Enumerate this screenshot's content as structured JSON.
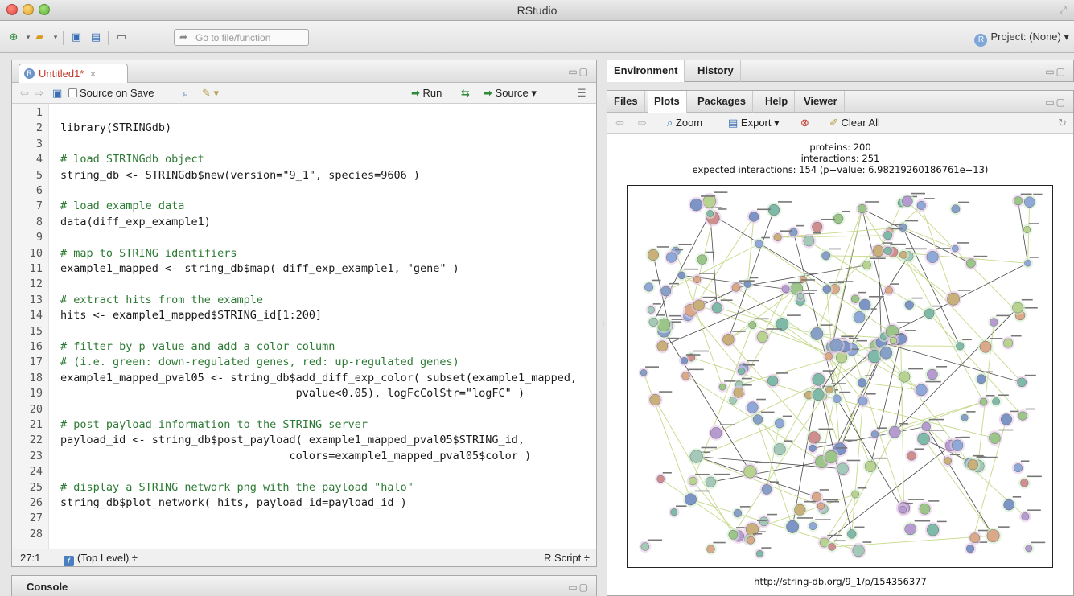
{
  "window": {
    "title": "RStudio"
  },
  "toolbar": {
    "goto_placeholder": "Go to file/function",
    "project_label": "Project: (None)",
    "project_icon": "R"
  },
  "editor": {
    "tab_label": "Untitled1*",
    "tab_close": "×",
    "source_on_save_label": "Source on Save",
    "run_label": "Run",
    "source_label": "Source",
    "lines": [
      {
        "n": "1",
        "text": "",
        "type": "code"
      },
      {
        "n": "2",
        "text": "library(STRINGdb)",
        "type": "code"
      },
      {
        "n": "3",
        "text": "",
        "type": "code"
      },
      {
        "n": "4",
        "text": "# load STRINGdb object",
        "type": "comment"
      },
      {
        "n": "5",
        "text": "string_db <- STRINGdb$new(version=\"9_1\", species=9606 )",
        "type": "code"
      },
      {
        "n": "6",
        "text": "",
        "type": "code"
      },
      {
        "n": "7",
        "text": "# load example data",
        "type": "comment"
      },
      {
        "n": "8",
        "text": "data(diff_exp_example1)",
        "type": "code"
      },
      {
        "n": "9",
        "text": "",
        "type": "code"
      },
      {
        "n": "10",
        "text": "# map to STRING identifiers",
        "type": "comment"
      },
      {
        "n": "11",
        "text": "example1_mapped <- string_db$map( diff_exp_example1, \"gene\" )",
        "type": "code"
      },
      {
        "n": "12",
        "text": "",
        "type": "code"
      },
      {
        "n": "13",
        "text": "# extract hits from the example",
        "type": "comment"
      },
      {
        "n": "14",
        "text": "hits <- example1_mapped$STRING_id[1:200]",
        "type": "code"
      },
      {
        "n": "15",
        "text": "",
        "type": "code"
      },
      {
        "n": "16",
        "text": "# filter by p-value and add a color column",
        "type": "comment"
      },
      {
        "n": "17",
        "text": "# (i.e. green: down-regulated genes, red: up-regulated genes)",
        "type": "comment"
      },
      {
        "n": "18",
        "text": "example1_mapped_pval05 <- string_db$add_diff_exp_color( subset(example1_mapped,",
        "type": "code"
      },
      {
        "n": "19",
        "text": "                                    pvalue<0.05), logFcColStr=\"logFC\" )",
        "type": "code"
      },
      {
        "n": "20",
        "text": "",
        "type": "code"
      },
      {
        "n": "21",
        "text": "# post payload information to the STRING server",
        "type": "comment"
      },
      {
        "n": "22",
        "text": "payload_id <- string_db$post_payload( example1_mapped_pval05$STRING_id,",
        "type": "code"
      },
      {
        "n": "23",
        "text": "                                   colors=example1_mapped_pval05$color )",
        "type": "code"
      },
      {
        "n": "24",
        "text": "",
        "type": "code"
      },
      {
        "n": "25",
        "text": "# display a STRING network png with the payload \"halo\"",
        "type": "comment"
      },
      {
        "n": "26",
        "text": "string_db$plot_network( hits, payload_id=payload_id )",
        "type": "code"
      },
      {
        "n": "27",
        "text": "",
        "type": "code"
      },
      {
        "n": "28",
        "text": "",
        "type": "code"
      }
    ],
    "status_position": "27:1",
    "status_scope": "(Top Level) ÷",
    "status_filetype": "R Script ÷"
  },
  "console": {
    "label": "Console"
  },
  "env_tabs": [
    "Environment",
    "History"
  ],
  "files_tabs": [
    "Files",
    "Plots",
    "Packages",
    "Help",
    "Viewer"
  ],
  "plot_toolbar": {
    "zoom": "Zoom",
    "export": "Export ▾",
    "clear_all": "Clear All"
  },
  "plot": {
    "header_lines": [
      "proteins: 200",
      "interactions: 251",
      "expected interactions: 154 (p−value: 6.98219260186761e−13)"
    ],
    "url": "http://string-db.org/9_1/p/154356377"
  },
  "colors": {
    "accent_blue": "#3b6fb5",
    "comment_green": "#2c7a34",
    "tab_red": "#c0392b"
  }
}
